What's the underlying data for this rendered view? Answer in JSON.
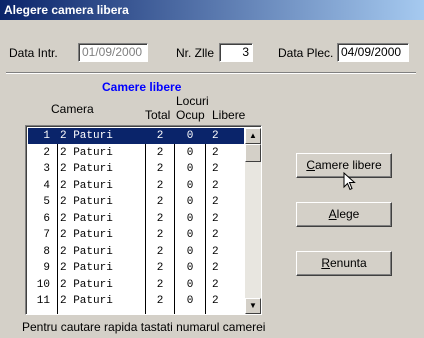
{
  "window": {
    "title": "Alegere camera libera"
  },
  "form": {
    "data_intr_label": "Data Intr.",
    "data_intr_value": "01/09/2000",
    "nr_zile_label": "Nr. Zlle",
    "nr_zile_value": "3",
    "data_plec_label": "Data Plec.",
    "data_plec_value": "04/09/2000"
  },
  "table": {
    "title": "Camere libere",
    "headers": {
      "camera": "Camera",
      "locuri": "Locuri",
      "total": "Total",
      "ocup": "Ocup",
      "libere": "Libere"
    },
    "rows": [
      [
        "1",
        "2 Paturi",
        "2",
        "0",
        "2"
      ],
      [
        "2",
        "2 Paturi",
        "2",
        "0",
        "2"
      ],
      [
        "3",
        "2 Paturi",
        "2",
        "0",
        "2"
      ],
      [
        "4",
        "2 Paturi",
        "2",
        "0",
        "2"
      ],
      [
        "5",
        "2 Paturi",
        "2",
        "0",
        "2"
      ],
      [
        "6",
        "2 Paturi",
        "2",
        "0",
        "2"
      ],
      [
        "7",
        "2 Paturi",
        "2",
        "0",
        "2"
      ],
      [
        "8",
        "2 Paturi",
        "2",
        "0",
        "2"
      ],
      [
        "9",
        "2 Paturi",
        "2",
        "0",
        "2"
      ],
      [
        "10",
        "2 Paturi",
        "2",
        "0",
        "2"
      ],
      [
        "11",
        "2 Paturi",
        "2",
        "0",
        "2"
      ]
    ],
    "selected_index": 0
  },
  "buttons": {
    "camere_libere": {
      "mnemonic": "C",
      "rest": "amere libere"
    },
    "alege": {
      "mnemonic": "A",
      "rest": "lege"
    },
    "renunta": {
      "mnemonic": "R",
      "rest": "enunta"
    }
  },
  "status": "Pentru cautare rapida tastati numarul camerei",
  "icons": {
    "scroll_up": "arrow-up-icon",
    "scroll_down": "arrow-down-icon",
    "cursor": "mouse-pointer-icon"
  }
}
